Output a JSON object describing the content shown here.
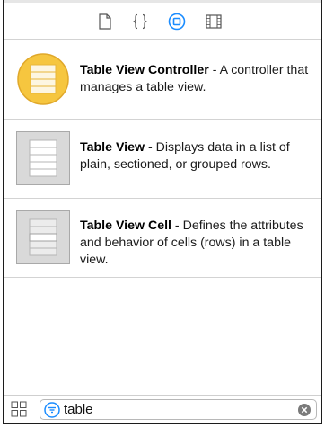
{
  "tabs": [
    {
      "name": "file-template-library",
      "icon": "file-icon"
    },
    {
      "name": "code-snippet-library",
      "icon": "braces-icon"
    },
    {
      "name": "object-library",
      "icon": "object-icon",
      "selected": true
    },
    {
      "name": "media-library",
      "icon": "film-icon"
    }
  ],
  "accent_color": "#1a8cff",
  "items": [
    {
      "title": "Table View Controller",
      "description": " - A controller that manages a table view.",
      "icon": "table-view-controller-icon",
      "icon_color": "#f6c63f"
    },
    {
      "title": "Table View",
      "description": " - Displays data in a list of plain, sectioned, or grouped rows.",
      "icon": "table-view-icon"
    },
    {
      "title": "Table View Cell",
      "description": " - Defines the attributes and behavior of cells (rows) in a table view.",
      "icon": "table-view-cell-icon"
    }
  ],
  "search": {
    "value": "table",
    "filter_icon": "filter-icon",
    "clear_icon": "clear-icon"
  },
  "bottom": {
    "grid_icon": "grid-view-icon"
  }
}
